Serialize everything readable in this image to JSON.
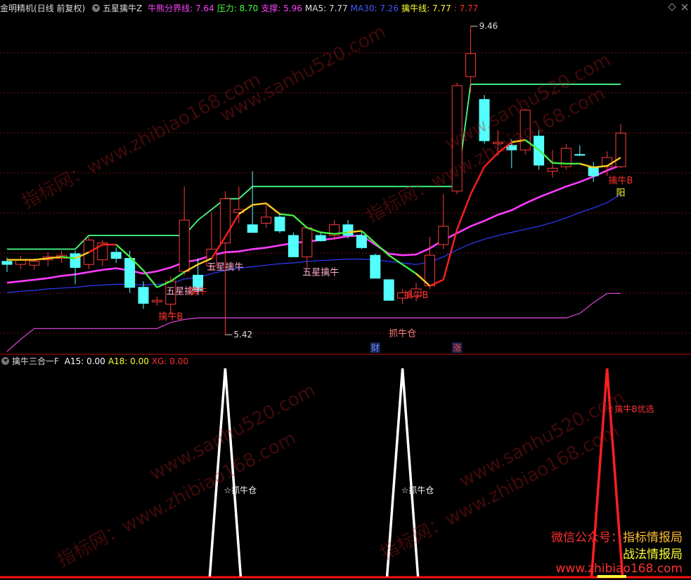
{
  "header": {
    "stock_name": "金明精机",
    "period": "(日线 前复权)",
    "indicator_name": "五星擒牛Z",
    "items": [
      {
        "label": "牛熊分界线:",
        "value": "7.64",
        "color": "#ff44ff"
      },
      {
        "label": "压力:",
        "value": "8.70",
        "color": "#44ff44"
      },
      {
        "label": "支撑:",
        "value": "5.96",
        "color": "#ff44ff"
      },
      {
        "label": "MA5:",
        "value": "7.77",
        "color": "#dddddd"
      },
      {
        "label": "MA30:",
        "value": "7.26",
        "color": "#3b5bff"
      },
      {
        "label": "擒牛线:",
        "value": "7.77",
        "color": "#ffff33"
      },
      {
        "label": ":",
        "value": "7.77",
        "color": "#ff3030"
      }
    ]
  },
  "sub_header": {
    "indicator_name": "擒牛三合一F",
    "items": [
      {
        "label": "A15:",
        "value": "0.00",
        "color": "#ffffff"
      },
      {
        "label": "A18:",
        "value": "0.00",
        "color": "#ffff33"
      },
      {
        "label": "XG:",
        "value": "0.00",
        "color": "#ff3030"
      }
    ]
  },
  "colors": {
    "up": "#ff3b3b",
    "down": "#54ffff",
    "resistance": "#44ff88",
    "bull_bear": "#ff3cff",
    "ma30": "#2e3cff",
    "support": "#d040d0",
    "grid": "#7a1010"
  },
  "chart_data": [
    {
      "type": "candlestick",
      "title": "",
      "ylim": [
        5.2,
        9.6
      ],
      "candles": [
        {
          "o": 6.38,
          "h": 6.43,
          "l": 6.24,
          "c": 6.34
        },
        {
          "o": 6.34,
          "h": 6.45,
          "l": 6.28,
          "c": 6.4
        },
        {
          "o": 6.33,
          "h": 6.42,
          "l": 6.27,
          "c": 6.38
        },
        {
          "o": 6.4,
          "h": 6.5,
          "l": 6.32,
          "c": 6.44
        },
        {
          "o": 6.42,
          "h": 6.52,
          "l": 6.36,
          "c": 6.46
        },
        {
          "o": 6.48,
          "h": 6.52,
          "l": 6.08,
          "c": 6.3
        },
        {
          "o": 6.34,
          "h": 6.7,
          "l": 6.28,
          "c": 6.66
        },
        {
          "o": 6.4,
          "h": 6.66,
          "l": 6.32,
          "c": 6.62
        },
        {
          "o": 6.5,
          "h": 6.56,
          "l": 6.36,
          "c": 6.42
        },
        {
          "o": 6.42,
          "h": 6.52,
          "l": 5.97,
          "c": 6.04
        },
        {
          "o": 6.04,
          "h": 6.12,
          "l": 5.76,
          "c": 5.83
        },
        {
          "o": 5.85,
          "h": 5.92,
          "l": 5.8,
          "c": 5.87
        },
        {
          "o": 5.82,
          "h": 6.18,
          "l": 5.7,
          "c": 6.12
        },
        {
          "o": 6.25,
          "h": 7.36,
          "l": 6.2,
          "c": 6.92
        },
        {
          "o": 6.2,
          "h": 6.42,
          "l": 5.97,
          "c": 6.0
        },
        {
          "o": 6.32,
          "h": 7.02,
          "l": 6.26,
          "c": 6.54
        },
        {
          "o": 6.62,
          "h": 7.3,
          "l": 5.42,
          "c": 7.2
        },
        {
          "o": 7.02,
          "h": 7.36,
          "l": 6.88,
          "c": 7.06
        },
        {
          "o": 6.86,
          "h": 7.56,
          "l": 6.8,
          "c": 6.76
        },
        {
          "o": 6.88,
          "h": 7.12,
          "l": 6.82,
          "c": 6.96
        },
        {
          "o": 6.96,
          "h": 7.0,
          "l": 6.75,
          "c": 6.78
        },
        {
          "o": 6.72,
          "h": 6.76,
          "l": 6.44,
          "c": 6.44
        },
        {
          "o": 6.44,
          "h": 6.84,
          "l": 6.3,
          "c": 6.82
        },
        {
          "o": 6.72,
          "h": 6.76,
          "l": 6.64,
          "c": 6.65
        },
        {
          "o": 6.72,
          "h": 6.92,
          "l": 6.66,
          "c": 6.86
        },
        {
          "o": 6.86,
          "h": 6.92,
          "l": 6.68,
          "c": 6.72
        },
        {
          "o": 6.72,
          "h": 6.77,
          "l": 6.54,
          "c": 6.56
        },
        {
          "o": 6.46,
          "h": 6.48,
          "l": 6.16,
          "c": 6.16
        },
        {
          "o": 6.14,
          "h": 6.14,
          "l": 5.87,
          "c": 5.87
        },
        {
          "o": 5.9,
          "h": 6.02,
          "l": 5.82,
          "c": 5.97
        },
        {
          "o": 5.92,
          "h": 6.1,
          "l": 5.86,
          "c": 6.02
        },
        {
          "o": 6.06,
          "h": 6.7,
          "l": 6.02,
          "c": 6.46
        },
        {
          "o": 6.6,
          "h": 7.26,
          "l": 6.54,
          "c": 6.84
        },
        {
          "o": 7.3,
          "h": 8.72,
          "l": 7.26,
          "c": 8.68
        },
        {
          "o": 8.8,
          "h": 9.46,
          "l": 8.6,
          "c": 9.1
        },
        {
          "o": 8.5,
          "h": 8.56,
          "l": 7.92,
          "c": 7.96
        },
        {
          "o": 7.92,
          "h": 8.1,
          "l": 7.76,
          "c": 7.94
        },
        {
          "o": 7.9,
          "h": 7.98,
          "l": 7.6,
          "c": 7.84
        },
        {
          "o": 7.84,
          "h": 8.38,
          "l": 7.78,
          "c": 8.36
        },
        {
          "o": 8.02,
          "h": 8.1,
          "l": 7.58,
          "c": 7.64
        },
        {
          "o": 7.56,
          "h": 7.84,
          "l": 7.48,
          "c": 7.6
        },
        {
          "o": 7.62,
          "h": 7.92,
          "l": 7.58,
          "c": 7.86
        },
        {
          "o": 7.78,
          "h": 7.9,
          "l": 7.76,
          "c": 7.77
        },
        {
          "o": 7.62,
          "h": 7.68,
          "l": 7.42,
          "c": 7.5
        },
        {
          "o": 7.62,
          "h": 7.82,
          "l": 7.5,
          "c": 7.74
        },
        {
          "o": 7.62,
          "h": 8.18,
          "l": 7.6,
          "c": 8.06
        }
      ],
      "resistance": [
        6.54,
        6.54,
        6.54,
        6.54,
        6.54,
        6.54,
        6.72,
        6.72,
        6.72,
        6.72,
        6.72,
        6.72,
        6.72,
        6.72,
        6.92,
        7.06,
        7.2,
        7.2,
        7.36,
        7.36,
        7.36,
        7.36,
        7.36,
        7.36,
        7.36,
        7.36,
        7.36,
        7.36,
        7.36,
        7.36,
        7.36,
        7.36,
        7.36,
        7.36,
        8.7,
        8.7,
        8.7,
        8.7,
        8.7,
        8.7,
        8.7,
        8.7,
        8.7,
        8.7,
        8.7,
        8.7
      ],
      "trend_line": [
        6.4,
        6.4,
        6.4,
        6.42,
        6.44,
        6.42,
        6.5,
        6.6,
        6.6,
        6.44,
        6.26,
        6.04,
        6.12,
        6.24,
        6.34,
        6.42,
        6.7,
        7.0,
        7.12,
        7.14,
        7.0,
        6.98,
        6.82,
        6.76,
        6.74,
        6.76,
        6.78,
        6.62,
        6.46,
        6.34,
        6.22,
        6.06,
        6.14,
        6.8,
        7.26,
        7.62,
        7.8,
        7.94,
        7.97,
        7.84,
        7.67,
        7.66,
        7.66,
        7.61,
        7.63,
        7.74
      ],
      "trend_state": [
        "y",
        "y",
        "y",
        "y",
        "y",
        "g",
        "y",
        "r",
        "r",
        "g",
        "g",
        "g",
        "g",
        "g",
        "y",
        "y",
        "r",
        "r",
        "y",
        "y",
        "y",
        "g",
        "g",
        "g",
        "g",
        "g",
        "y",
        "g",
        "g",
        "g",
        "g",
        "y",
        "r",
        "r",
        "r",
        "r",
        "r",
        "r",
        "y",
        "g",
        "g",
        "g",
        "g",
        "y",
        "y",
        "y"
      ],
      "bull_bear": [
        6.1,
        6.12,
        6.14,
        6.16,
        6.19,
        6.21,
        6.24,
        6.27,
        6.29,
        6.26,
        6.22,
        6.25,
        6.3,
        6.37,
        6.4,
        6.46,
        6.5,
        6.51,
        6.54,
        6.56,
        6.59,
        6.62,
        6.64,
        6.66,
        6.68,
        6.71,
        6.72,
        6.6,
        6.48,
        6.46,
        6.47,
        6.55,
        6.66,
        6.75,
        6.84,
        6.91,
        6.99,
        7.05,
        7.14,
        7.22,
        7.29,
        7.36,
        7.42,
        7.49,
        7.57,
        7.64
      ],
      "ma30": [
        5.97,
        5.99,
        6.0,
        6.02,
        6.03,
        6.04,
        6.06,
        6.07,
        6.08,
        6.08,
        6.07,
        6.08,
        6.09,
        6.15,
        6.17,
        6.22,
        6.26,
        6.29,
        6.31,
        6.33,
        6.35,
        6.36,
        6.38,
        6.39,
        6.4,
        6.41,
        6.41,
        6.4,
        6.38,
        6.36,
        6.34,
        6.37,
        6.44,
        6.53,
        6.61,
        6.67,
        6.72,
        6.76,
        6.8,
        6.84,
        6.89,
        6.95,
        7.02,
        7.08,
        7.15,
        7.26
      ],
      "support": [
        5.2,
        5.36,
        5.5,
        5.5,
        5.5,
        5.5,
        5.5,
        5.5,
        5.5,
        5.5,
        5.5,
        5.5,
        5.58,
        5.62,
        5.64,
        5.64,
        5.64,
        5.64,
        5.64,
        5.64,
        5.64,
        5.64,
        5.64,
        5.64,
        5.64,
        5.64,
        5.64,
        5.64,
        5.64,
        5.64,
        5.64,
        5.64,
        5.64,
        5.64,
        5.64,
        5.64,
        5.64,
        5.64,
        5.64,
        5.64,
        5.64,
        5.64,
        5.7,
        5.84,
        5.96,
        5.96
      ],
      "annotations": [
        {
          "i": 16,
          "price": 5.42,
          "text": "5.42",
          "kind": "low"
        },
        {
          "i": 34,
          "price": 9.46,
          "text": "9.46",
          "kind": "high"
        },
        {
          "i": 12,
          "price": 5.62,
          "text": "擒牛B",
          "color": "#ff3030"
        },
        {
          "i": 13,
          "price": 5.95,
          "text": "五星擒牛",
          "color": "#ffaad0"
        },
        {
          "i": 14,
          "price": 5.95,
          "text": "擒牛",
          "color": "#ff3030"
        },
        {
          "i": 16,
          "price": 6.27,
          "text": "五星擒牛",
          "color": "#ffaad0"
        },
        {
          "i": 23,
          "price": 6.2,
          "text": "五星擒牛",
          "color": "#ffaad0"
        },
        {
          "i": 30,
          "price": 5.9,
          "text": "擒牛B",
          "color": "#ff3030"
        },
        {
          "i": 29,
          "price": 5.4,
          "text": "抓牛仓",
          "color": "#ff8080"
        },
        {
          "i": 45,
          "price": 7.4,
          "text": "擒牛B",
          "color": "#ff3030"
        },
        {
          "i": 45,
          "price": 7.24,
          "text": "阳",
          "color": "#ffff33"
        }
      ],
      "badges": [
        {
          "i": 27,
          "text": "财",
          "color": "#6a8cff"
        },
        {
          "i": 33,
          "text": "涨",
          "color": "#ff4040"
        }
      ]
    },
    {
      "type": "line",
      "title": "",
      "ylim": [
        0,
        1
      ],
      "spikes": [
        {
          "i": 16,
          "height": 1.0,
          "color": "#ffffff",
          "label": "☆抓牛仓"
        },
        {
          "i": 29,
          "height": 1.0,
          "color": "#ffffff",
          "label": "☆抓牛仓"
        },
        {
          "i": 44,
          "height": 1.0,
          "color": "#ff2020",
          "label": "☆擒牛B优选"
        }
      ]
    }
  ],
  "watermarks": [
    "指标网：www.zhibiao168.com",
    "www.sanhu520.com"
  ],
  "promo": {
    "line1a": "微信公众号：",
    "line1b": "指标情报局",
    "line2": "战法情报局",
    "line3": "www.zhibiao168.com"
  }
}
